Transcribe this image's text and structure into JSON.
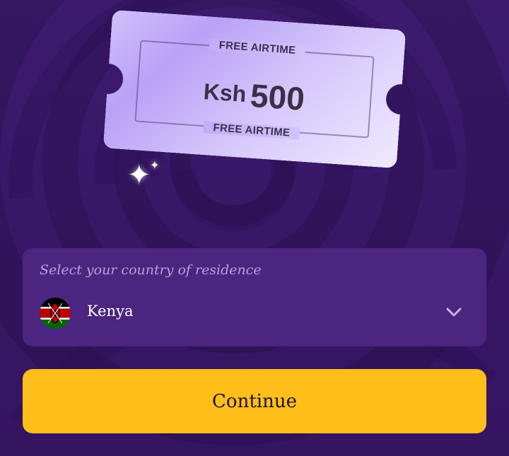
{
  "ticket": {
    "top_label": "FREE AIRTIME",
    "currency": "Ksh",
    "amount": "500",
    "bottom_label": "FREE AIRTIME"
  },
  "country_select": {
    "label": "Select your country of residence",
    "selected_value": "Kenya",
    "flag_icon": "kenya-flag-icon"
  },
  "continue_button": {
    "label": "Continue"
  },
  "colors": {
    "background": "#3a1968",
    "select_background": "#4b2580",
    "button": "#ffbe1a",
    "ticket": "#c9b6f9"
  }
}
